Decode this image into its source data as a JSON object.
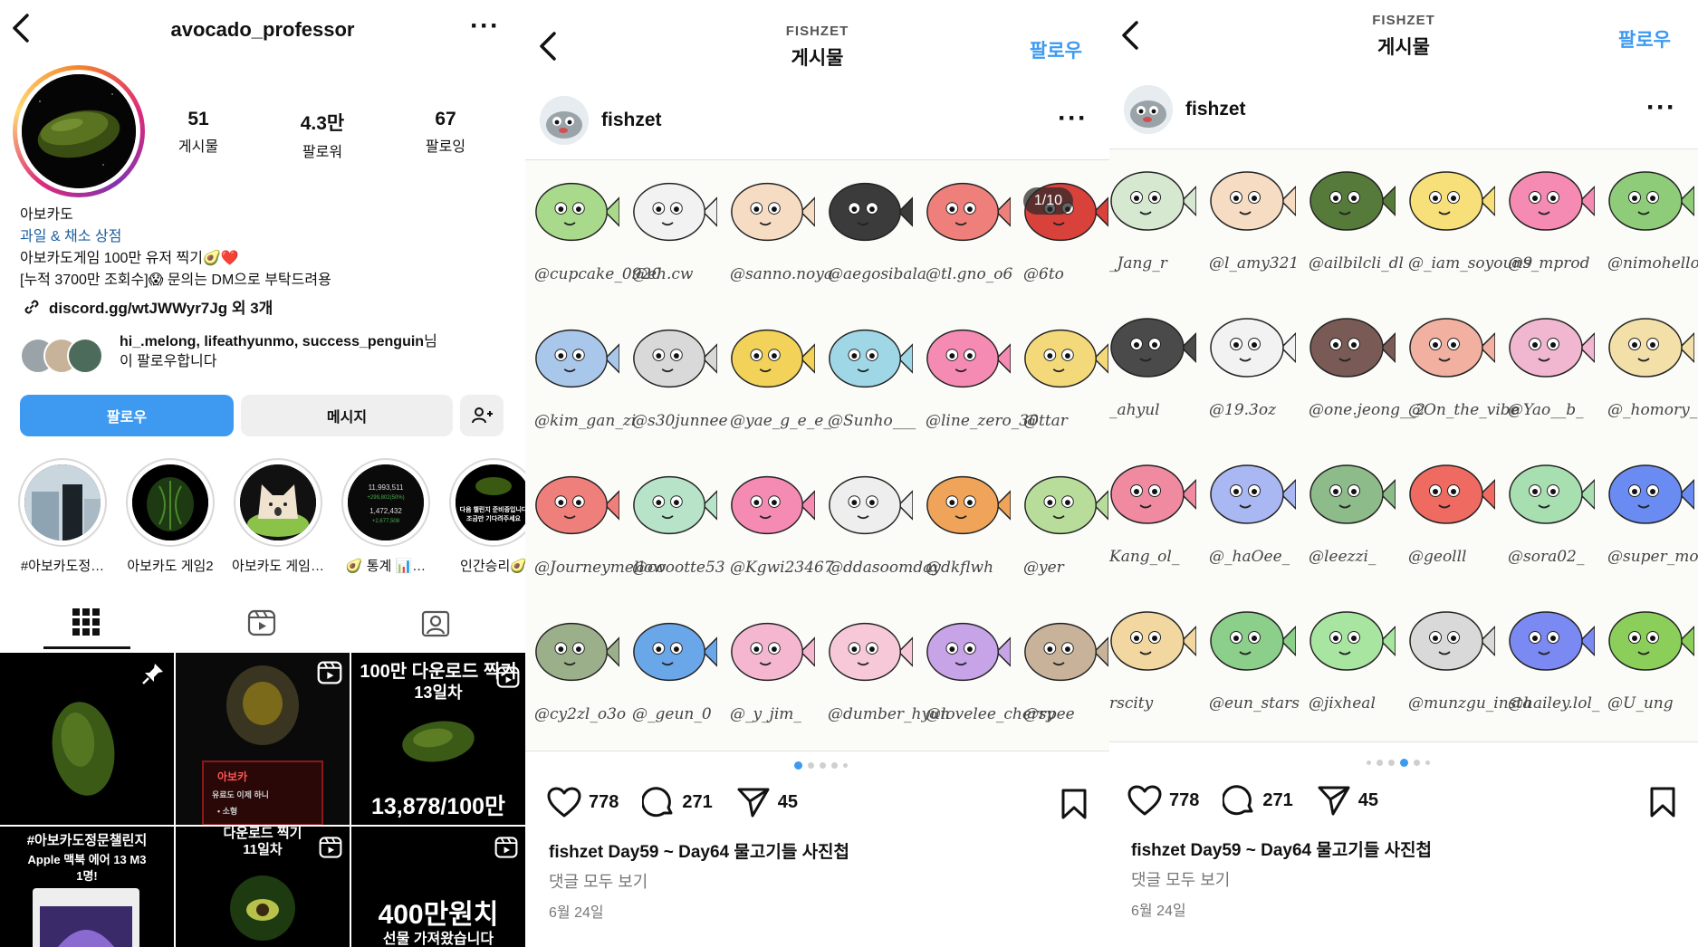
{
  "profile": {
    "username": "avocado_professor",
    "stats": [
      {
        "num": "51",
        "label": "게시물"
      },
      {
        "num": "4.3만",
        "label": "팔로워"
      },
      {
        "num": "67",
        "label": "팔로잉"
      }
    ],
    "display_name": "아보카도",
    "category": "과일 & 채소 상점",
    "bio_line1": "아보카도게임 100만 유저 찍기🥑❤️",
    "bio_line2": "[누적 3700만 조회수]😱 문의는 DM으로 부탁드려용",
    "link": "discord.gg/wtJWWyr7Jg 외 3개",
    "followed_by_names": "hi_.melong, lifeathyunmo, success_penguin",
    "followed_by_suffix_1": "님",
    "followed_by_suffix_2": "이 팔로우합니다",
    "follow_button": "팔로우",
    "message_button": "메시지",
    "highlights": [
      {
        "label": "#아보카도정…"
      },
      {
        "label": "아보카도 게임2"
      },
      {
        "label": "아보카도 게임…"
      },
      {
        "label": "🥑 통계 📊…"
      },
      {
        "label": "인간승리🥑"
      }
    ],
    "highlight_stats_small": [
      "11,993,511",
      "+299,802(50%)",
      "1,472,432",
      "+2,677,508"
    ],
    "highlight_victory_text": [
      "다음 챌린지 준비중입니다",
      "조금만 기다려주세요"
    ],
    "tiles": {
      "t3_title": "100만 다운로드 찍기",
      "t3_day": "13일차",
      "t3_count": "13,878/100만",
      "t2_small": [
        "아보카",
        "유료도 이제 하니",
        "• 소형"
      ],
      "t4_title": "#아보카도정문챌린지",
      "t4_sub": "Apple 맥북 에어 13 M3",
      "t4_sub2": "1명!",
      "t5_title": "다운로드 찍기",
      "t5_day": "11일차",
      "t6_title": "400만원치",
      "t6_sub": "선물 가져왔습니다"
    }
  },
  "posts": [
    {
      "account_caps": "FISHZET",
      "title": "게시물",
      "follow": "팔로우",
      "author": "fishzet",
      "counter": "1/10",
      "handles": [
        "@cupcake_0920",
        "@eh.cw",
        "@sanno.noya",
        "@aegosibala",
        "@tl.gno_o6",
        "@6to",
        "@kim_gan_zi",
        "@s30junnee",
        "@yae_g_e_e_",
        "@Sunho___",
        "@line_zero_30",
        "@ttar",
        "@Journeymellow",
        "@coootte53",
        "@Kgwi23467",
        "@ddasoomday",
        "@dkflwh",
        "@yer",
        "@cy2zl_o3o",
        "@_geun_0",
        "@_y_jim_",
        "@dumber_hyun",
        "@lovelee_cherry",
        "@spee"
      ],
      "likes": "778",
      "comments": "271",
      "shares": "45",
      "caption_user": "fishzet",
      "caption_text": "Day59 ~ Day64 물고기들 사진첩",
      "view_all": "댓글 모두 보기",
      "date": "6월 24일"
    },
    {
      "account_caps": "FISHZET",
      "title": "게시물",
      "follow": "팔로우",
      "author": "fishzet",
      "handles": [
        "_Jang_r",
        "@l_amy321",
        "@ailbilcli_dl",
        "@_iam_soyoun9",
        "@s_mprod",
        "@nimohello",
        "_ahyul",
        "@19.3oz",
        "@one.jeong__2",
        "@On_the_vibe",
        "@Yao__b_",
        "@_homory_",
        "Kang_ol_",
        "@_haOee_",
        "@leezzi_",
        "@geolll",
        "@sora02_",
        "@super_moog",
        "rscity",
        "@eun_stars",
        "@jixheal",
        "@munzgu_insta",
        "@hailey.lol_",
        "@U_ung"
      ],
      "likes": "778",
      "comments": "271",
      "shares": "45",
      "caption_user": "fishzet",
      "caption_text": "Day59 ~ Day64 물고기들 사진첩",
      "view_all": "댓글 모두 보기",
      "date": "6월 24일"
    }
  ],
  "icons": [
    "back-arrow-icon",
    "more-icon",
    "link-icon",
    "add-person-icon",
    "grid-icon",
    "reels-icon",
    "tagged-icon",
    "pin-icon",
    "reel-badge-icon",
    "heart-icon",
    "comment-icon",
    "share-icon",
    "bookmark-icon"
  ],
  "colors": {
    "accent_blue": "#3d9af0",
    "category_blue": "#1d5f9f",
    "button_gray": "#efefef"
  }
}
